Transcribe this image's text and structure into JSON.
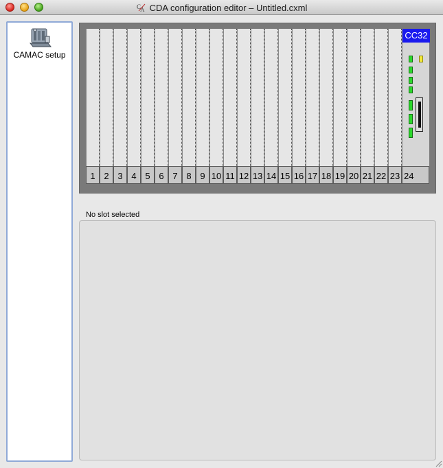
{
  "window": {
    "title": "CDA configuration editor – Untitled.cxml"
  },
  "sidebar": {
    "items": [
      {
        "label": "CAMAC setup",
        "icon": "camac-crate-icon"
      }
    ]
  },
  "crate": {
    "slots": [
      "1",
      "2",
      "3",
      "4",
      "5",
      "6",
      "7",
      "8",
      "9",
      "10",
      "11",
      "12",
      "13",
      "14",
      "15",
      "16",
      "17",
      "18",
      "19",
      "20",
      "21",
      "22",
      "23"
    ],
    "controller": {
      "label": "CC32",
      "slot": "24"
    }
  },
  "details": {
    "status": "No slot selected"
  },
  "colors": {
    "controller_header": "#1a1aee",
    "led_green": "#2bd82b",
    "led_yellow": "#f3ea3a",
    "crate_frame": "#7a7a7a"
  }
}
